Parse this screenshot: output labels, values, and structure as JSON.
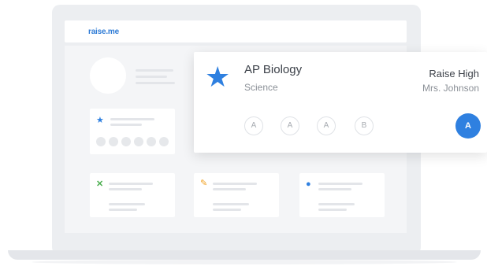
{
  "app": {
    "logo": "raise.me"
  },
  "course_card": {
    "title": "AP Biology",
    "subject": "Science",
    "school": "Raise High",
    "teacher": "Mrs. Johnson",
    "grades": [
      "A",
      "A",
      "A",
      "B"
    ],
    "current_grade": "A",
    "accent_color": "#2f80e0"
  },
  "tiles": [
    {
      "icon": "star-icon"
    },
    {
      "icon": "cross-icon"
    },
    {
      "icon": "pencil-icon"
    },
    {
      "icon": "search-icon"
    }
  ]
}
